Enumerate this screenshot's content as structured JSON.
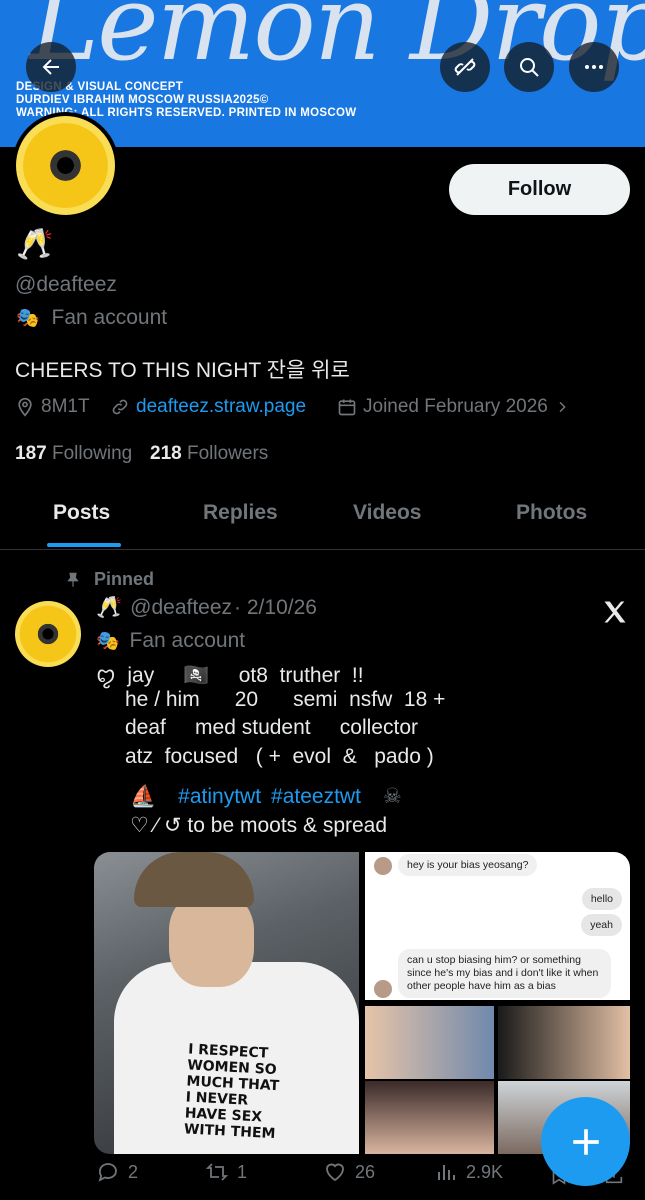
{
  "banner": {
    "title": "Lemon Drop",
    "lines": [
      "DESIGN & VISUAL CONCEPT",
      "DURDIEV IBRAHIM  MOSCOW  RUSSIA2025©",
      "WARNING: ALL RIGHTS RESERVED. PRINTED IN MOSCOW"
    ],
    "color": "#1877e0"
  },
  "profile": {
    "display_emoji": "🥂",
    "handle": "@deafteez",
    "category": "Fan account",
    "bio": "CHEERS TO THIS NIGHT 잔을 위로",
    "location": "8M1T",
    "link": "deafteez.straw.page",
    "joined": "Joined February 2026",
    "following_count": "187",
    "following_label": "Following",
    "followers_count": "218",
    "followers_label": "Followers",
    "follow_label": "Follow"
  },
  "tabs": [
    "Posts",
    "Replies",
    "Videos",
    "Photos"
  ],
  "post": {
    "pinned_label": "Pinned",
    "name_emoji": "🥂",
    "handle": "@deafteez",
    "date": "· 2/10/26",
    "category": "Fan account",
    "bio_lines": [
      "ꨄ  jay     🏴‍☠️     ot8  truther  !!",
      "he / him      20      semi  nsfw  18 +",
      "deaf     med student     collector",
      "atz  focused   ( +  evol  &   pado )"
    ],
    "hashtag_prefix": "⛵",
    "hashtag1": "#atinytwt",
    "hashtag2": "#ateeztwt",
    "hashtag_suffix": "☠",
    "closing": "♡ ⁄ ↺ to be moots & spread",
    "shirt_text": "I RESPECT WOMEN SO MUCH THAT I NEVER HAVE SEX WITH THEM",
    "chat": {
      "q1": "hey is your bias yeosang?",
      "r1": "hello",
      "r2": "yeah",
      "q2": "can u stop biasing him? or something since he's my bias and i don't like it when other people have him as a bias"
    },
    "stats": {
      "replies": "2",
      "reposts": "1",
      "likes": "26",
      "views": "2.9K"
    }
  },
  "icons": [
    "back-arrow-icon",
    "broken-link-icon",
    "search-icon",
    "more-icon",
    "location-icon",
    "link-icon",
    "calendar-icon",
    "pin-icon",
    "x-logo-icon",
    "reply-icon",
    "repost-icon",
    "like-icon",
    "views-icon",
    "bookmark-icon",
    "share-icon",
    "plus-icon"
  ],
  "colors": {
    "accent": "#1d9bf0",
    "muted": "#71767b",
    "text": "#e7e9ea"
  }
}
